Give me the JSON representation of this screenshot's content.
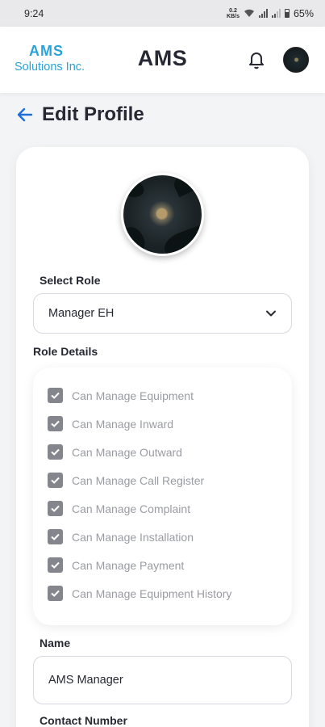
{
  "status_bar": {
    "time": "9:24",
    "net_speed_top": "0.2",
    "net_speed_bottom": "KB/s",
    "battery": "65%"
  },
  "header": {
    "logo_top": "AMS",
    "logo_bottom": "Solutions Inc.",
    "title": "AMS"
  },
  "page": {
    "title": "Edit Profile"
  },
  "form": {
    "select_role_label": "Select Role",
    "role_value": "Manager EH",
    "role_details_label": "Role Details",
    "permissions": [
      {
        "label": "Can Manage Equipment",
        "checked": true
      },
      {
        "label": "Can Manage Inward",
        "checked": true
      },
      {
        "label": "Can Manage Outward",
        "checked": true
      },
      {
        "label": "Can Manage Call Register",
        "checked": true
      },
      {
        "label": "Can Manage Complaint",
        "checked": true
      },
      {
        "label": "Can Manage Installation",
        "checked": true
      },
      {
        "label": "Can Manage Payment",
        "checked": true
      },
      {
        "label": "Can Manage Equipment History",
        "checked": true
      }
    ],
    "name_label": "Name",
    "name_value": "AMS Manager",
    "contact_label": "Contact Number"
  },
  "colors": {
    "accent": "#1e6fd9",
    "logo": "#29a3d9",
    "checkbox": "#83868d"
  }
}
